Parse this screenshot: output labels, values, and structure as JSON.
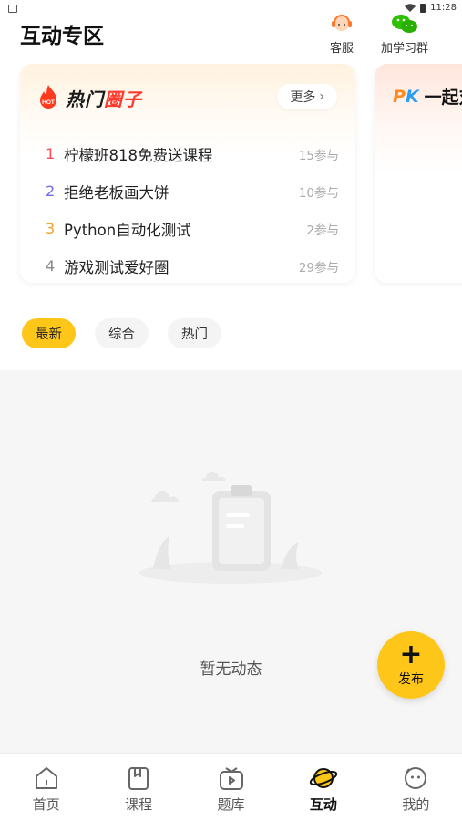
{
  "status_bar": {
    "time": "11:28"
  },
  "header": {
    "title": "互动专区",
    "service_label": "客服",
    "group_label": "加学习群"
  },
  "hot_circles": {
    "title_part1": "热门",
    "title_part2": "圈子",
    "hot_badge": "HOT",
    "more_label": "更多",
    "items": [
      {
        "rank": "1",
        "name": "柠檬班818免费送课程",
        "count": "15参与"
      },
      {
        "rank": "2",
        "name": "拒绝老板画大饼",
        "count": "10参与"
      },
      {
        "rank": "3",
        "name": "Python自动化测试",
        "count": "2参与"
      },
      {
        "rank": "4",
        "name": "游戏测试爱好圈",
        "count": "29参与"
      }
    ]
  },
  "pk_card": {
    "badge_p": "P",
    "badge_k": "K",
    "title": "一起对"
  },
  "filters": {
    "latest": "最新",
    "general": "综合",
    "popular": "热门"
  },
  "feed": {
    "empty_text": "暂无动态"
  },
  "fab": {
    "label": "发布"
  },
  "tabbar": {
    "home": "首页",
    "courses": "课程",
    "questions": "题库",
    "interact": "互动",
    "mine": "我的"
  },
  "colors": {
    "accent": "#ffc61a",
    "hot_red": "#ff3b30"
  }
}
